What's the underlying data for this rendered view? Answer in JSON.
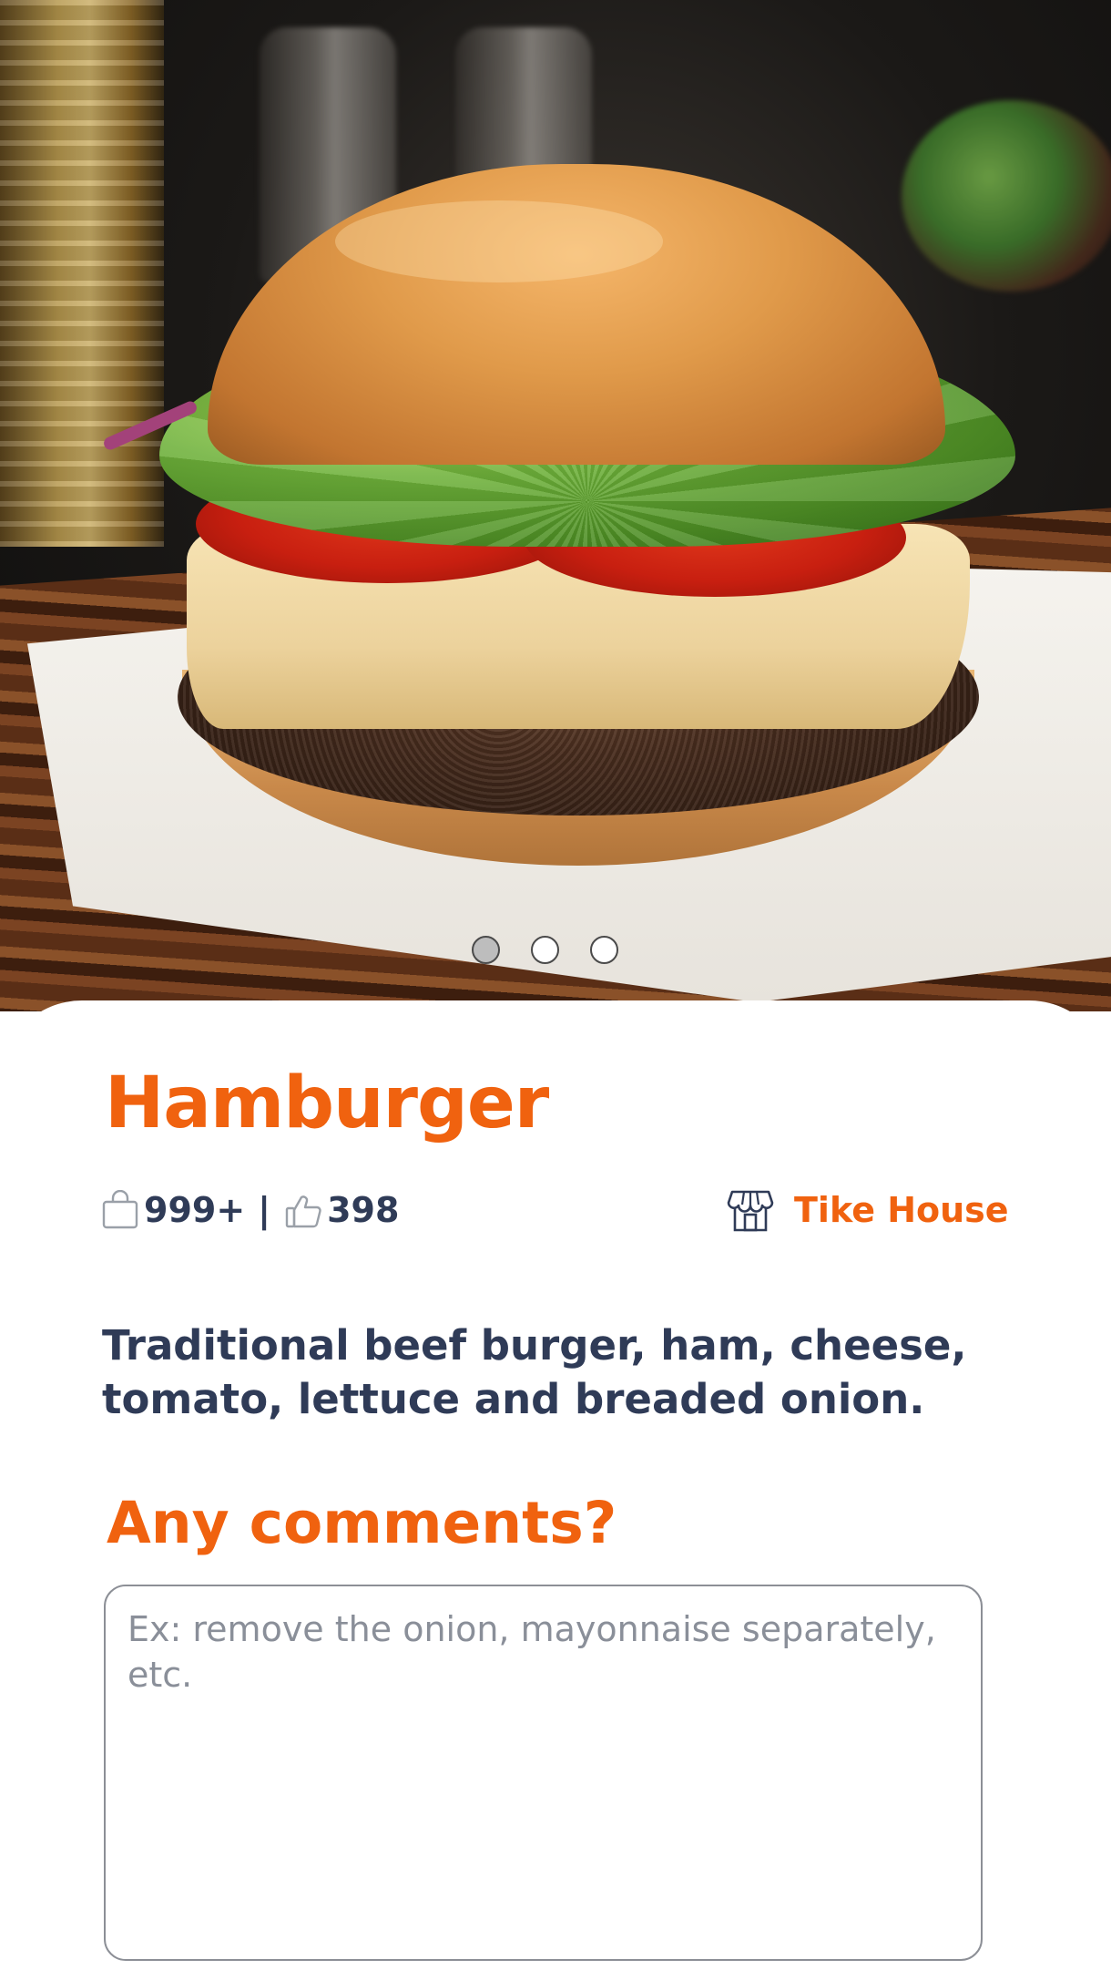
{
  "carousel": {
    "slides": 3,
    "active_index": 0
  },
  "product": {
    "name": "Hamburger",
    "orders_count": "999+",
    "separator": "|",
    "likes_count": "398",
    "store_name": "Tike House",
    "description": "Traditional beef burger, ham, cheese, tomato, lettuce and breaded onion."
  },
  "comments": {
    "title": "Any comments?",
    "placeholder": "Ex: remove the onion, mayonnaise separately, etc.",
    "value": ""
  },
  "icons": {
    "orders": "shopping-bag-icon",
    "likes": "thumbs-up-icon",
    "store": "storefront-icon"
  },
  "colors": {
    "accent": "#f0620f",
    "text_dark": "#2f3b57",
    "placeholder": "#8a8f99"
  }
}
